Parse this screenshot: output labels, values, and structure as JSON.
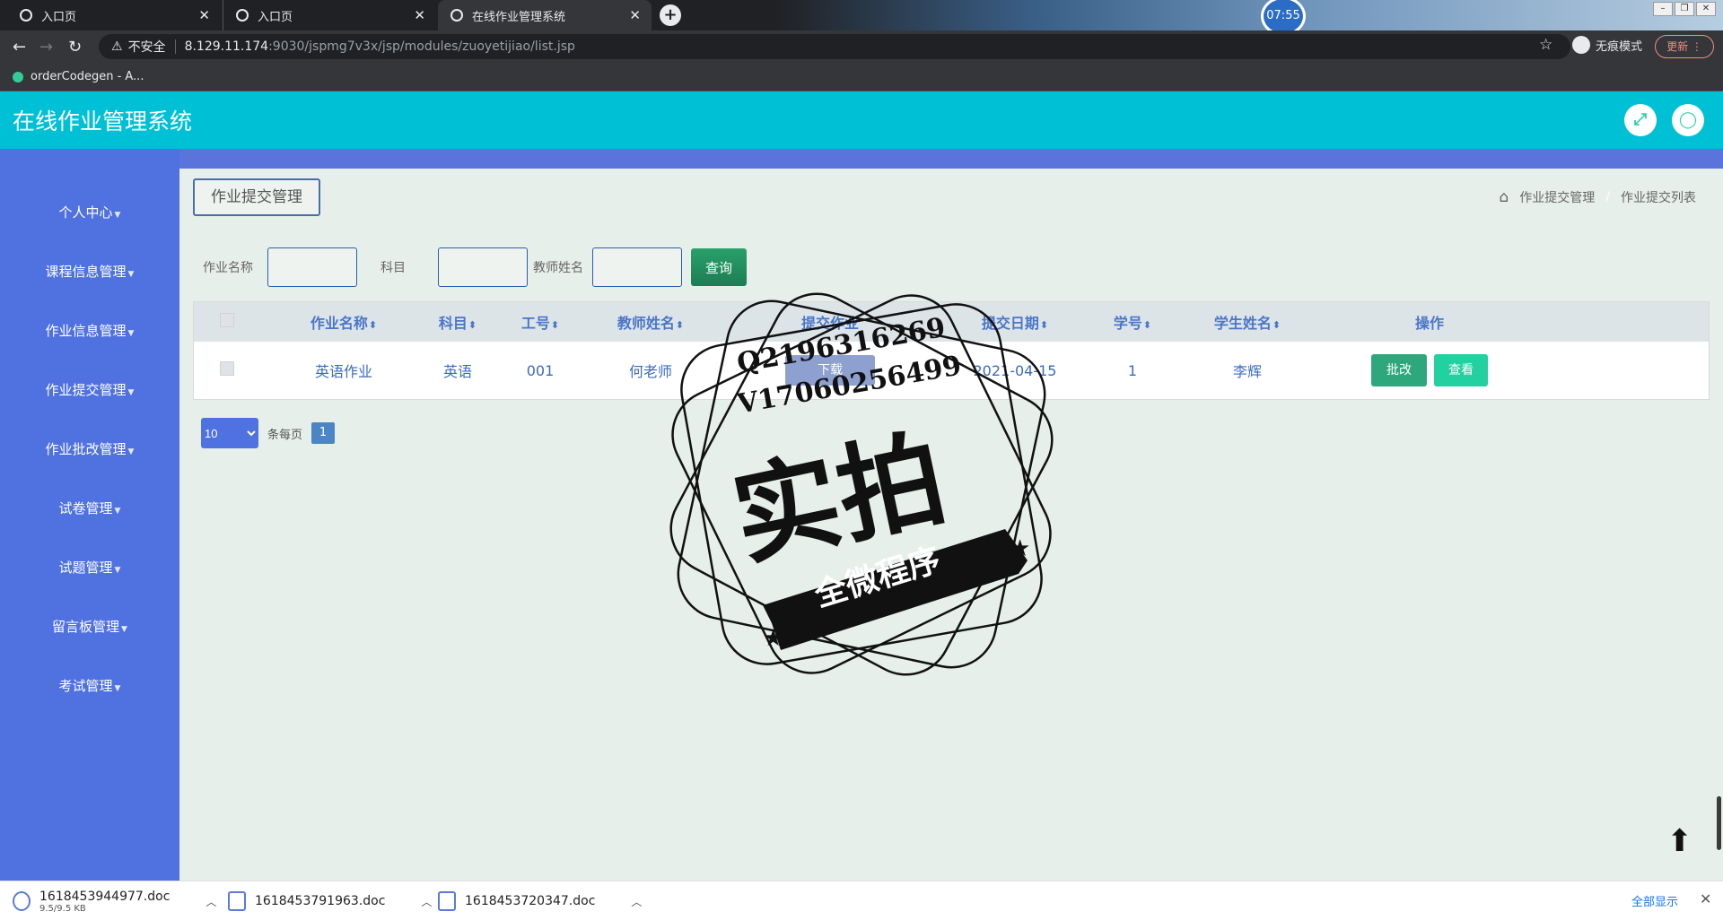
{
  "browser": {
    "tabs": [
      {
        "title": "入口页"
      },
      {
        "title": "入口页"
      },
      {
        "title": "在线作业管理系统"
      }
    ],
    "clock": "07:55",
    "security_label": "不安全",
    "url_host": "8.129.11.174",
    "url_path": ":9030/jspmg7v3x/jsp/modules/zuoyetijiao/list.jsp",
    "incognito_label": "无痕模式",
    "update_label": "更新",
    "bookmark": "orderCodegen - A..."
  },
  "header": {
    "title": "在线作业管理系统"
  },
  "sidebar": {
    "items": [
      {
        "label": "个人中心"
      },
      {
        "label": "课程信息管理"
      },
      {
        "label": "作业信息管理"
      },
      {
        "label": "作业提交管理"
      },
      {
        "label": "作业批改管理"
      },
      {
        "label": "试卷管理"
      },
      {
        "label": "试题管理"
      },
      {
        "label": "留言板管理"
      },
      {
        "label": "考试管理"
      }
    ]
  },
  "page": {
    "title": "作业提交管理",
    "breadcrumb": [
      "作业提交管理",
      "作业提交列表"
    ]
  },
  "search": {
    "homework_name_label": "作业名称",
    "subject_label": "科目",
    "teacher_label": "教师姓名",
    "query_button": "查询"
  },
  "table": {
    "headers": [
      "作业名称",
      "科目",
      "工号",
      "教师姓名",
      "提交作业",
      "提交日期",
      "学号",
      "学生姓名",
      "操作"
    ],
    "rows": [
      {
        "homework_name": "英语作业",
        "subject": "英语",
        "job_no": "001",
        "teacher": "何老师",
        "submission": "下载",
        "date": "2021-04-15",
        "student_no": "1",
        "student_name": "李辉",
        "edit": "批改",
        "view": "查看"
      }
    ]
  },
  "pagination": {
    "page_size": "10",
    "per_page_label": "条每页",
    "current_page": "1"
  },
  "watermark": {
    "line1": "Q2196316269",
    "line2": "V17060256499",
    "big": "实拍",
    "banner": "全微程序"
  },
  "downloads": [
    {
      "name": "1618453944977.doc",
      "size": "9.5/9.5 KB"
    },
    {
      "name": "1618453791963.doc"
    },
    {
      "name": "1618453720347.doc"
    }
  ],
  "downloads_show_all": "全部显示"
}
